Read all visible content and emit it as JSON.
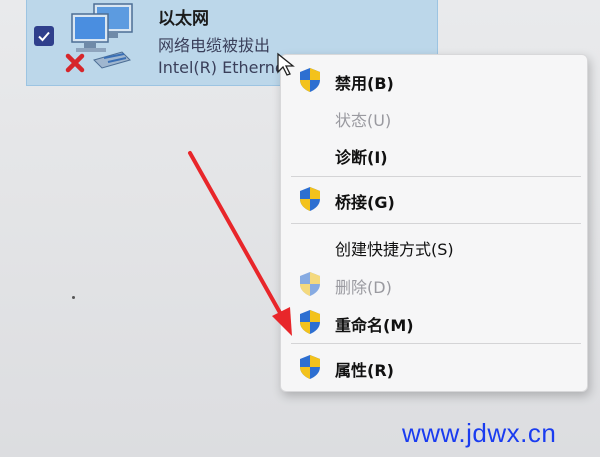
{
  "adapter": {
    "name": "以太网",
    "status": "网络电缆被拔出",
    "device": "Intel(R) Ethernet Connection",
    "checked": true,
    "icon": "network-computer-icon",
    "error_icon": "red-x-icon"
  },
  "context_menu": {
    "items": [
      {
        "label": "禁用(B)",
        "shield": true,
        "enabled": true
      },
      {
        "label": "状态(U)",
        "shield": false,
        "enabled": false
      },
      {
        "label": "诊断(I)",
        "shield": false,
        "enabled": true
      },
      {
        "label": "桥接(G)",
        "shield": true,
        "enabled": true
      },
      {
        "label": "创建快捷方式(S)",
        "shield": false,
        "enabled": true
      },
      {
        "label": "删除(D)",
        "shield": true,
        "enabled": false
      },
      {
        "label": "重命名(M)",
        "shield": true,
        "enabled": true
      },
      {
        "label": "属性(R)",
        "shield": true,
        "enabled": true
      }
    ]
  },
  "watermark": "www.jdwx.cn",
  "colors": {
    "accent_arrow": "#e8262a",
    "selection": "#bcd7ea",
    "watermark": "#1a3cf0"
  }
}
